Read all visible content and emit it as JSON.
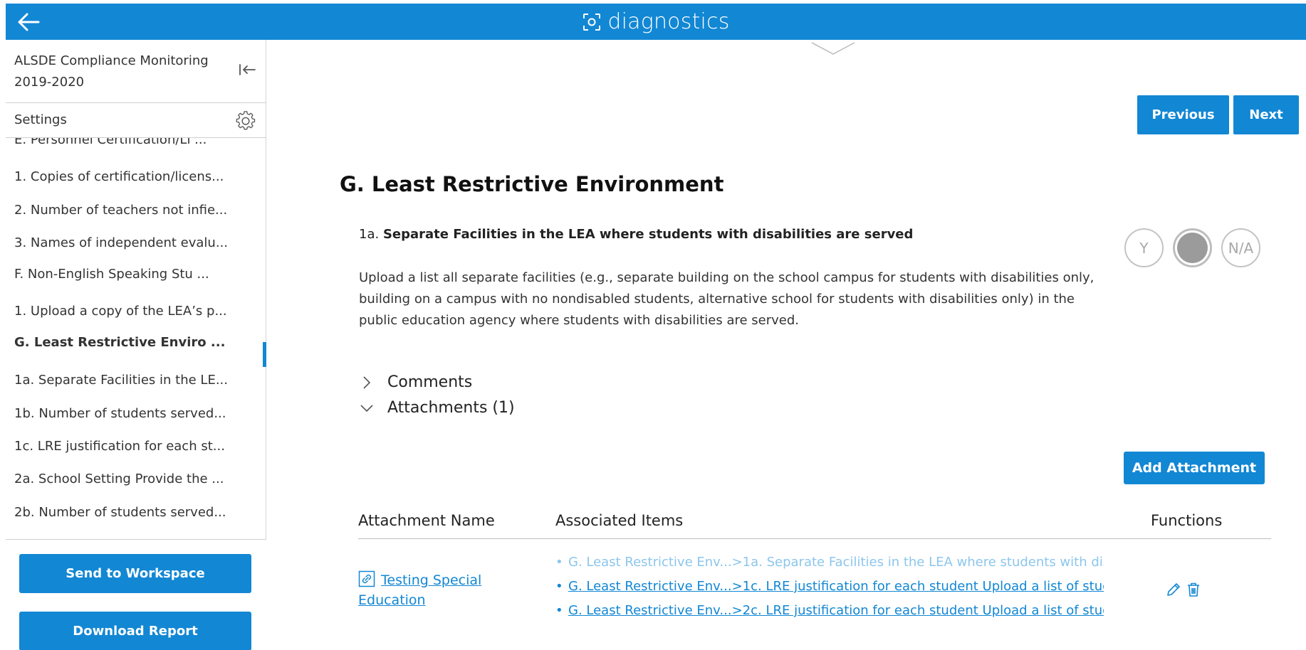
{
  "app": {
    "title": "diagnostics"
  },
  "sidebar": {
    "title": "ALSDE Compliance Monitoring 2019-2020",
    "settings_label": "Settings",
    "items": [
      {
        "label": "E. Personnel Certification/Li ..."
      },
      {
        "label": "1. Copies of certification/licens..."
      },
      {
        "label": "2. Number of teachers not infie..."
      },
      {
        "label": "3. Names of independent evalu..."
      },
      {
        "label": "F. Non-English Speaking Stu ..."
      },
      {
        "label": "1. Upload a copy of the LEA’s p..."
      },
      {
        "label": "G. Least Restrictive Enviro ..."
      },
      {
        "label": "1a. Separate Facilities in the LE..."
      },
      {
        "label": "1b. Number of students served..."
      },
      {
        "label": "1c. LRE justification for each st..."
      },
      {
        "label": "2a. School Setting Provide the ..."
      },
      {
        "label": "2b. Number of students served..."
      }
    ],
    "send_button": "Send to Workspace",
    "download_button": "Download Report"
  },
  "pager": {
    "previous": "Previous",
    "next": "Next"
  },
  "section": {
    "title": "G. Least Restrictive Environment"
  },
  "question": {
    "number": "1a.",
    "title": "Separate Facilities in the LEA where students with disabilities are served",
    "description": "Upload a list all separate facilities (e.g., separate building on the school campus for students with disabilities only, building on a campus with no nondisabled students, alternative school for students with disabilities only) in the public education agency where students with disabilities are served.",
    "answers": [
      {
        "label": "Y",
        "selected": false
      },
      {
        "label": "",
        "selected": true
      },
      {
        "label": "N/A",
        "selected": false
      }
    ]
  },
  "panels": {
    "comments": "Comments",
    "attachments": "Attachments (1)"
  },
  "attachments": {
    "add_button": "Add Attachment",
    "columns": {
      "name": "Attachment Name",
      "items": "Associated Items",
      "functions": "Functions"
    },
    "rows": [
      {
        "name": "Testing Special Education",
        "associated": [
          "G. Least Restrictive Env...>1a. Separate Facilities in the LEA where students with dis...",
          "G. Least Restrictive Env...>1c. LRE justification for each student Upload a list of stud...",
          "G. Least Restrictive Env...>2c. LRE justification for each student Upload a list of stud..."
        ]
      }
    ]
  },
  "colors": {
    "accent": "#1287d4",
    "faded_link": "#8cc6ec",
    "selected_answer": "#9b9b9b"
  },
  "icons": [
    "back-arrow-icon",
    "focus-scan-icon",
    "collapse-sidebar-icon",
    "gear-icon",
    "chevron-down-icon",
    "chevron-right-icon",
    "link-icon",
    "pencil-icon",
    "trash-icon"
  ]
}
